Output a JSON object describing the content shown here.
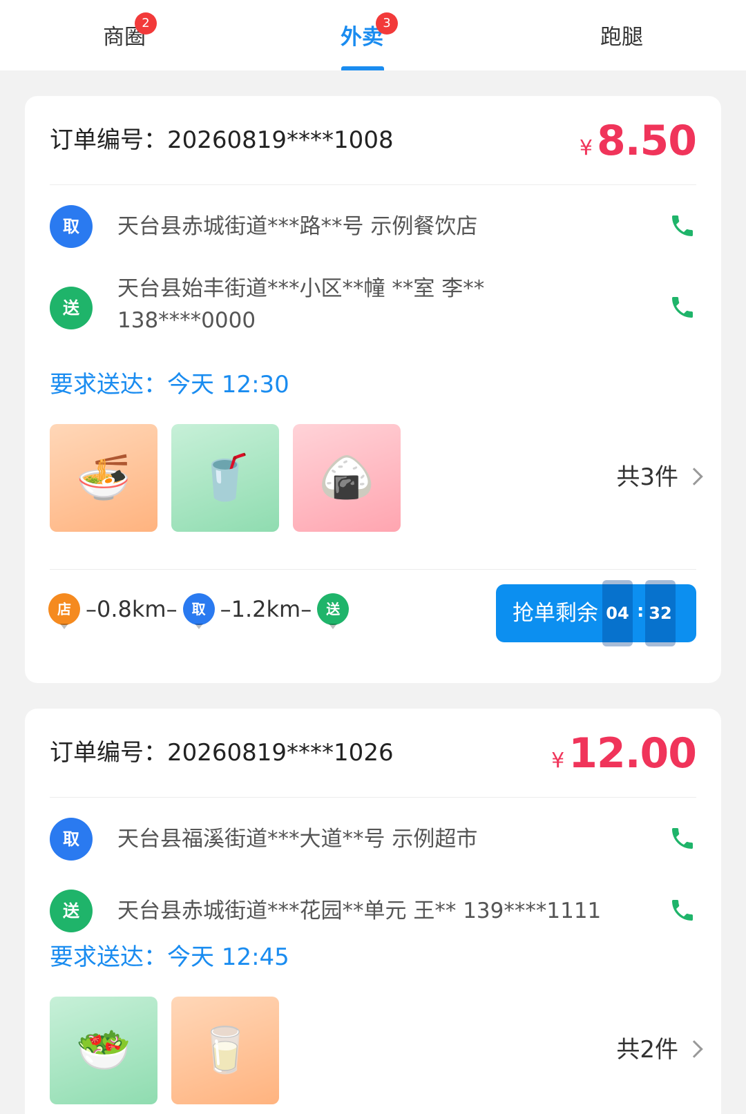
{
  "tabs": [
    {
      "label": "商圈",
      "badge": "2"
    },
    {
      "label": "外卖",
      "badge": "3"
    },
    {
      "label": "跑腿"
    }
  ],
  "orders": [
    {
      "order_no": "订单编号：20260819****1008",
      "currency": "¥",
      "price": "8.50",
      "pickup_badge": "取",
      "pickup_address": "天台县赤城街道***路**号 示例餐饮店",
      "delivery_badge": "送",
      "delivery_address": "天台县始丰街道***小区**幢 **室 李** 138****0000",
      "deadline": "要求送达：今天 12:30",
      "items": [
        "🍜",
        "🥤",
        "🍙"
      ],
      "count": "共3件",
      "route": {
        "store": "店",
        "take": "取",
        "send": "送",
        "dist1": "–0.8km–",
        "dist2": "–1.2km–"
      },
      "grab": {
        "label": "抢单剩余",
        "minutes": "04",
        "colon": ":",
        "seconds": "32"
      }
    },
    {
      "order_no": "订单编号：20260819****1026",
      "currency": "¥",
      "price": "12.00",
      "pickup_badge": "取",
      "pickup_address": "天台县福溪街道***大道**号 示例超市",
      "delivery_badge": "送",
      "delivery_address": "天台县赤城街道***花园**单元 王** 139****1111",
      "deadline": "要求送达：今天 12:45",
      "items": [
        "🥗",
        "🥛"
      ],
      "count": "共2件"
    }
  ],
  "colors": {
    "accent": "#1a8cf0",
    "price": "#f0345a",
    "pickup": "#2a7af0",
    "delivery": "#1fb46a",
    "store": "#f58a1f",
    "phone": "#1fb46a"
  }
}
